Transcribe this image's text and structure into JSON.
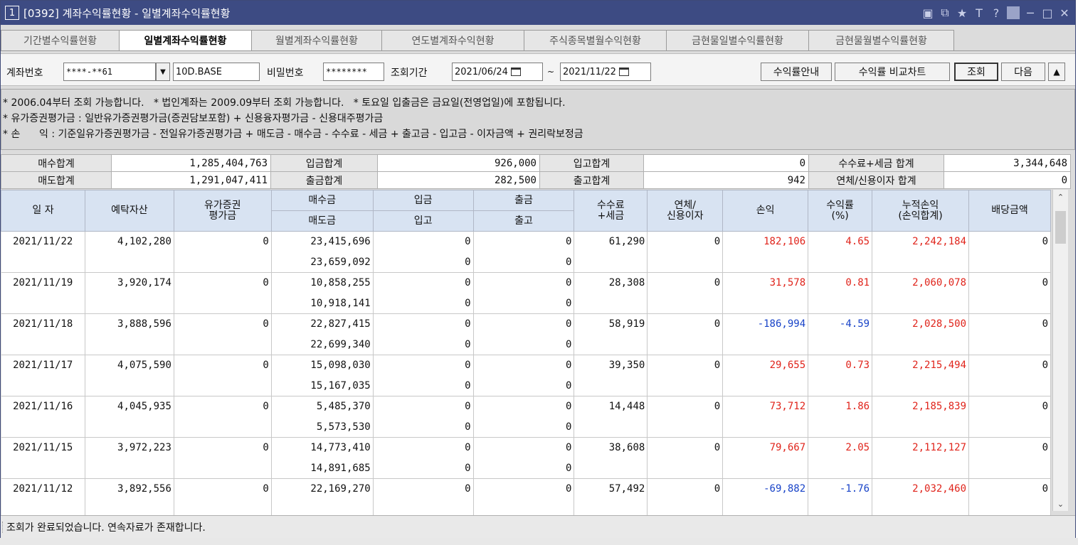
{
  "window": {
    "number": "1",
    "title": "[0392] 계좌수익률현황 - 일별계좌수익률현황",
    "icons": [
      "restore-icon",
      "popout-icon",
      "pin-icon",
      "font-icon",
      "help-icon",
      "minimize-icon",
      "maximize-icon",
      "close-icon"
    ]
  },
  "tabs": [
    {
      "label": "기간별수익률현황",
      "active": false
    },
    {
      "label": "일별계좌수익률현황",
      "active": true
    },
    {
      "label": "월별계좌수익률현황",
      "active": false
    },
    {
      "label": "연도별계좌수익현황",
      "active": false
    },
    {
      "label": "주식종목별월수익현황",
      "active": false
    },
    {
      "label": "금현물일별수익률현황",
      "active": false
    },
    {
      "label": "금현물월별수익률현황",
      "active": false
    }
  ],
  "query": {
    "account_label": "계좌번호",
    "account_value": "****-**61",
    "account_name": "10D.BASE",
    "password_label": "비밀번호",
    "password_value": "********",
    "period_label": "조회기간",
    "start_date": "2021/06/24",
    "tilde": "~",
    "end_date": "2021/11/22",
    "guide_button": "수익률안내",
    "compare_button": "수익률 비교차트",
    "search_button": "조회",
    "next_button": "다음",
    "collapse_glyph": "▲"
  },
  "notes": [
    "* 2006.04부터 조회 가능합니다.   * 법인계좌는 2009.09부터 조회 가능합니다.   * 토요일 입출금은 금요일(전영업일)에 포함됩니다.",
    "* 유가증권평가금 : 일반유가증권평가금(증권담보포함) + 신용융자평가금 - 신용대주평가금",
    "* 손      익 : 기준일유가증권평가금 - 전일유가증권평가금 + 매도금 - 매수금 - 수수료 - 세금 + 출고금 - 입고금 - 이자금액 + 권리락보정금"
  ],
  "summary": {
    "row1": {
      "buy_total_label": "매수합계",
      "buy_total": "1,285,404,763",
      "deposit_total_label": "입금합계",
      "deposit_total": "926,000",
      "in_total_label": "입고합계",
      "in_total": "0",
      "fee_tax_label": "수수료+세금 합계",
      "fee_tax": "3,344,648"
    },
    "row2": {
      "sell_total_label": "매도합계",
      "sell_total": "1,291,047,411",
      "withdraw_total_label": "출금합계",
      "withdraw_total": "282,500",
      "out_total_label": "출고합계",
      "out_total": "942",
      "interest_label": "연체/신용이자 합계",
      "interest": "0"
    }
  },
  "grid": {
    "headers": {
      "date": "일 자",
      "deposit_asset": "예탁자산",
      "securities": "유가증권\n평가금",
      "buy": "매수금",
      "sell": "매도금",
      "deposit": "입금",
      "incoming": "입고",
      "withdraw": "출금",
      "outgoing": "출고",
      "fee_tax": "수수료\n+세금",
      "interest": "연체/\n신용이자",
      "pnl": "손익",
      "rate": "수익률\n(%)",
      "cum_pnl": "누적손익\n(손익합계)",
      "dividend": "배당금액"
    },
    "rows": [
      {
        "date": "2021/11/22",
        "asset": "4,102,280",
        "sec": "0",
        "buy": "23,415,696",
        "sell": "23,659,092",
        "dep": "0",
        "in": "0",
        "wd": "0",
        "out": "0",
        "fee": "61,290",
        "int": "0",
        "pnl": "182,106",
        "rate": "4.65",
        "cum": "2,242,184",
        "div": "0",
        "sign": "pos"
      },
      {
        "date": "2021/11/19",
        "asset": "3,920,174",
        "sec": "0",
        "buy": "10,858,255",
        "sell": "10,918,141",
        "dep": "0",
        "in": "0",
        "wd": "0",
        "out": "0",
        "fee": "28,308",
        "int": "0",
        "pnl": "31,578",
        "rate": "0.81",
        "cum": "2,060,078",
        "div": "0",
        "sign": "pos"
      },
      {
        "date": "2021/11/18",
        "asset": "3,888,596",
        "sec": "0",
        "buy": "22,827,415",
        "sell": "22,699,340",
        "dep": "0",
        "in": "0",
        "wd": "0",
        "out": "0",
        "fee": "58,919",
        "int": "0",
        "pnl": "-186,994",
        "rate": "-4.59",
        "cum": "2,028,500",
        "div": "0",
        "sign": "neg"
      },
      {
        "date": "2021/11/17",
        "asset": "4,075,590",
        "sec": "0",
        "buy": "15,098,030",
        "sell": "15,167,035",
        "dep": "0",
        "in": "0",
        "wd": "0",
        "out": "0",
        "fee": "39,350",
        "int": "0",
        "pnl": "29,655",
        "rate": "0.73",
        "cum": "2,215,494",
        "div": "0",
        "sign": "pos"
      },
      {
        "date": "2021/11/16",
        "asset": "4,045,935",
        "sec": "0",
        "buy": "5,485,370",
        "sell": "5,573,530",
        "dep": "0",
        "in": "0",
        "wd": "0",
        "out": "0",
        "fee": "14,448",
        "int": "0",
        "pnl": "73,712",
        "rate": "1.86",
        "cum": "2,185,839",
        "div": "0",
        "sign": "pos"
      },
      {
        "date": "2021/11/15",
        "asset": "3,972,223",
        "sec": "0",
        "buy": "14,773,410",
        "sell": "14,891,685",
        "dep": "0",
        "in": "0",
        "wd": "0",
        "out": "0",
        "fee": "38,608",
        "int": "0",
        "pnl": "79,667",
        "rate": "2.05",
        "cum": "2,112,127",
        "div": "0",
        "sign": "pos"
      },
      {
        "date": "2021/11/12",
        "asset": "3,892,556",
        "sec": "0",
        "buy": "22,169,270",
        "sell": "",
        "dep": "0",
        "in": "",
        "wd": "0",
        "out": "",
        "fee": "57,492",
        "int": "0",
        "pnl": "-69,882",
        "rate": "-1.76",
        "cum": "2,032,460",
        "div": "0",
        "sign": "neg"
      }
    ]
  },
  "status": {
    "message": "조회가 완료되었습니다. 연속자료가 존재합니다."
  },
  "colors": {
    "titlebar": "#3d4b83",
    "header": "#d8e3f2",
    "positive": "#e0241b",
    "negative": "#1843c8"
  }
}
